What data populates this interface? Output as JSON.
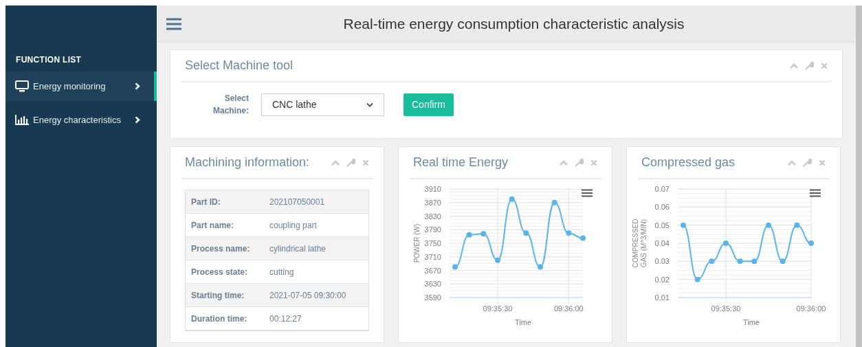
{
  "sidebar": {
    "heading": "FUNCTION LIST",
    "items": [
      {
        "label": "Energy monitoring",
        "selected": true
      },
      {
        "label": "Energy characteristics",
        "selected": false
      }
    ]
  },
  "header": {
    "title": "Real-time energy consumption characteristic analysis"
  },
  "machine_panel": {
    "title": "Select Machine tool",
    "field_label": "Select Machine:",
    "select_value": "CNC lathe",
    "button": "Confirm"
  },
  "info_panel": {
    "title": "Machining information:",
    "rows": [
      {
        "label": "Part ID:",
        "value": "202107050001"
      },
      {
        "label": "Part name:",
        "value": "coupling part"
      },
      {
        "label": "Process name:",
        "value": "cylindrical lathe"
      },
      {
        "label": "Process state:",
        "value": "cutting"
      },
      {
        "label": "Starting time:",
        "value": "2021-07-05 09:30:00"
      },
      {
        "label": "Duration time:",
        "value": "00:12:27"
      }
    ]
  },
  "chart_panels": [
    {
      "title": "Real time Energy",
      "chart_data": {
        "type": "line",
        "xlabel": "Time",
        "ylabel": "POWER (W)",
        "categories": [
          null,
          null,
          null,
          "09:35:30",
          null,
          null,
          null,
          null,
          "09:36:00",
          null
        ],
        "grid": true,
        "series": [
          {
            "color": "#5ab4e8",
            "marker": "circle",
            "values": [
              3680,
              3775,
              3778,
              3700,
              3880,
              3780,
              3680,
              3870,
              3780,
              3765
            ]
          }
        ],
        "ylim": [
          3590,
          3910
        ],
        "yticks": [
          3590,
          3630,
          3670,
          3710,
          3750,
          3790,
          3830,
          3870,
          3910
        ]
      }
    },
    {
      "title": "Compressed gas",
      "chart_data": {
        "type": "line",
        "xlabel": "Time",
        "ylabel": "COMPRESSED GAS (M^3/MIN)",
        "categories": [
          null,
          null,
          null,
          "09:35:30",
          null,
          null,
          null,
          null,
          null,
          "09:36:00"
        ],
        "grid": true,
        "series": [
          {
            "color": "#5ab4e8",
            "marker": "circle",
            "values": [
              0.05,
              0.02,
              0.03,
              0.04,
              0.03,
              0.03,
              0.05,
              0.03,
              0.05,
              0.04
            ]
          }
        ],
        "ylim": [
          0.01,
          0.07
        ],
        "yticks": [
          0.01,
          0.02,
          0.03,
          0.04,
          0.05,
          0.06,
          0.07
        ]
      }
    }
  ]
}
